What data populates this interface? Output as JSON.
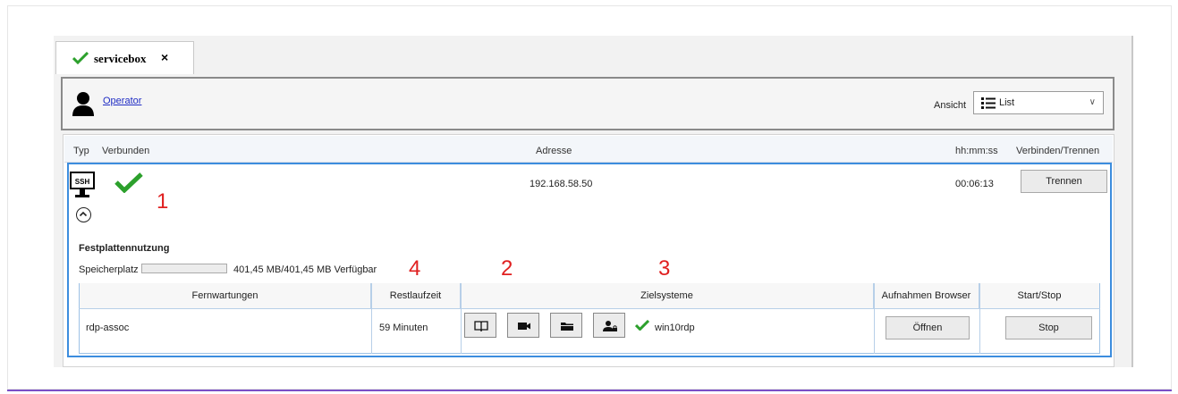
{
  "tab": {
    "label": "servicebox",
    "close": "×",
    "status_color": "#2ca02c"
  },
  "toolbar": {
    "user_link": "Operator",
    "view_label": "Ansicht",
    "view_value": "List"
  },
  "table": {
    "headers": {
      "type": "Typ",
      "connected": "Verbunden",
      "address": "Adresse",
      "time": "hh:mm:ss",
      "action": "Verbinden/Trennen"
    },
    "row": {
      "type_badge": "SSH",
      "address": "192.168.58.50",
      "time": "00:06:13",
      "action_button": "Trennen"
    }
  },
  "disk": {
    "title": "Festplattennutzung",
    "label": "Speicherplatz",
    "usage_text": "401,45 MB/401,45 MB Verfügbar",
    "fill_fraction": 0
  },
  "sessions": {
    "headers": {
      "remote": "Fernwartungen",
      "remaining": "Restlaufzeit",
      "targets": "Zielsysteme",
      "recordings": "Aufnahmen Browser",
      "startstop": "Start/Stop"
    },
    "row": {
      "remote": "rdp-assoc",
      "remaining": "59 Minuten",
      "target_name": "win10rdp",
      "open_button": "Öffnen",
      "stop_button": "Stop"
    }
  },
  "annotations": {
    "a1": "1",
    "a2": "2",
    "a3": "3",
    "a4": "4"
  },
  "colors": {
    "accent_blue": "#3c8dde",
    "check_green": "#2ca02c",
    "annotation_red": "#e02020",
    "link_blue": "#1f2cc4"
  }
}
